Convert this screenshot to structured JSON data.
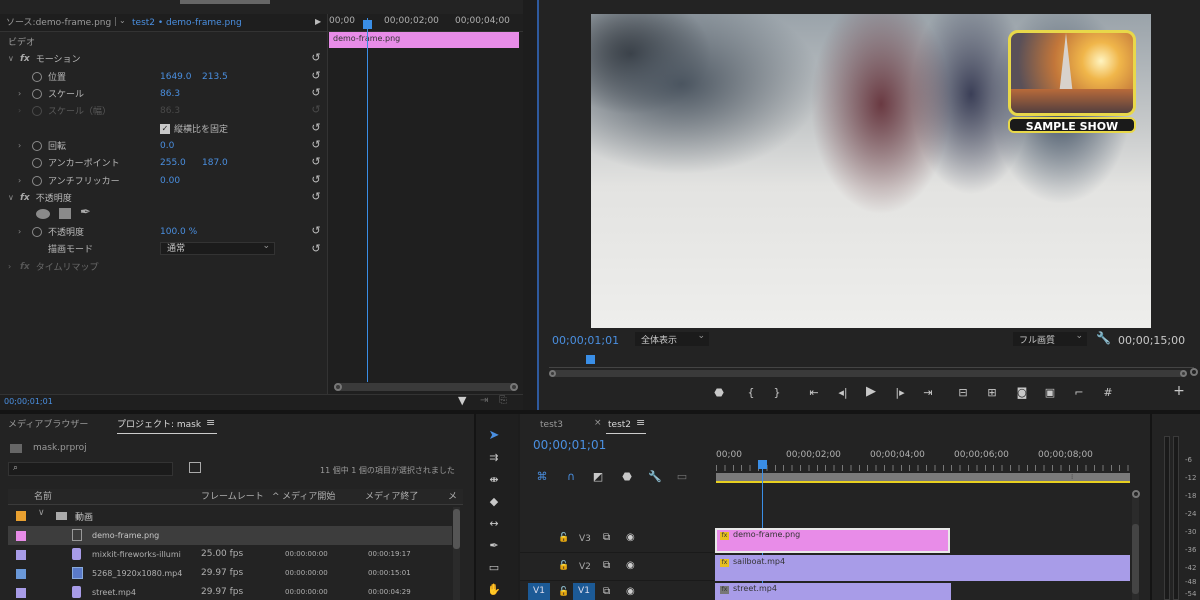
{
  "effect_controls": {
    "source_tab": "ソース:demo-frame.png",
    "sequence_tab": "test2 • demo-frame.png",
    "section_video": "ビデオ",
    "motion": {
      "label": "モーション",
      "position_label": "位置",
      "position_x": "1649.0",
      "position_y": "213.5",
      "scale_label": "スケール",
      "scale_value": "86.3",
      "scale_w_label": "スケール（幅）",
      "scale_w_value": "86.3",
      "uniform_scale_label": "縦横比を固定",
      "rotation_label": "回転",
      "rotation_value": "0.0",
      "anchor_label": "アンカーポイント",
      "anchor_x": "255.0",
      "anchor_y": "187.0",
      "antiflicker_label": "アンチフリッカー",
      "antiflicker_value": "0.00"
    },
    "opacity": {
      "label": "不透明度",
      "opacity_label": "不透明度",
      "opacity_value": "100.0 %",
      "blend_label": "描画モード",
      "blend_value": "通常"
    },
    "time_remap_label": "タイムリマップ",
    "timecode": "00;00;01;01",
    "ruler": [
      "00;00",
      "00;00;02;00",
      "00;00;04;00"
    ],
    "clip_label": "demo-frame.png"
  },
  "program_monitor": {
    "timecode": "00;00;01;01",
    "zoom_value": "全体表示",
    "quality_value": "フル画質",
    "duration": "00;00;15;00",
    "overlay_caption": "SAMPLE SHOW"
  },
  "project": {
    "tab_media_browser": "メディアブラウザー",
    "tab_project": "プロジェクト: mask",
    "project_file": "mask.prproj",
    "selection_status": "11 個中 1 個の項目が選択されました",
    "columns": [
      "名前",
      "フレームレート",
      "メディア開始",
      "メディア終了",
      "メ"
    ],
    "folder_name": "動画",
    "items": [
      {
        "name": "demo-frame.png",
        "fps": "",
        "start": "",
        "end": "",
        "color": "#e88ce8"
      },
      {
        "name": "mixkit-fireworks-illumi",
        "fps": "25.00 fps",
        "start": "00:00:00:00",
        "end": "00:00:19:17",
        "color": "#a89ce8"
      },
      {
        "name": "5268_1920x1080.mp4",
        "fps": "29.97 fps",
        "start": "00:00:00:00",
        "end": "00:00:15:01",
        "color": "#6a98d8"
      },
      {
        "name": "street.mp4",
        "fps": "29.97 fps",
        "start": "00:00:00:00",
        "end": "00:00:04:29",
        "color": "#a89ce8"
      }
    ]
  },
  "timeline": {
    "tab_test3": "test3",
    "tab_test2": "test2",
    "timecode": "00;00;01;01",
    "ruler": [
      "00;00",
      "00;00;02;00",
      "00;00;04;00",
      "00;00;06;00",
      "00;00;08;00"
    ],
    "tracks": [
      {
        "name": "V3",
        "clip": "demo-frame.png"
      },
      {
        "name": "V2",
        "clip": "sailboat.mp4"
      },
      {
        "name": "V1",
        "clip": "street.mp4",
        "source_patch": "V1"
      }
    ]
  },
  "audio_meter": {
    "labels": [
      "-6",
      "-12",
      "-18",
      "-24",
      "-30",
      "-36",
      "-42",
      "-48",
      "-54"
    ]
  },
  "colors": {
    "accent_blue": "#4a8fe0",
    "clip_pink": "#e88ce8",
    "clip_purple": "#a89ce8",
    "playhead": "#3a8ee6"
  }
}
